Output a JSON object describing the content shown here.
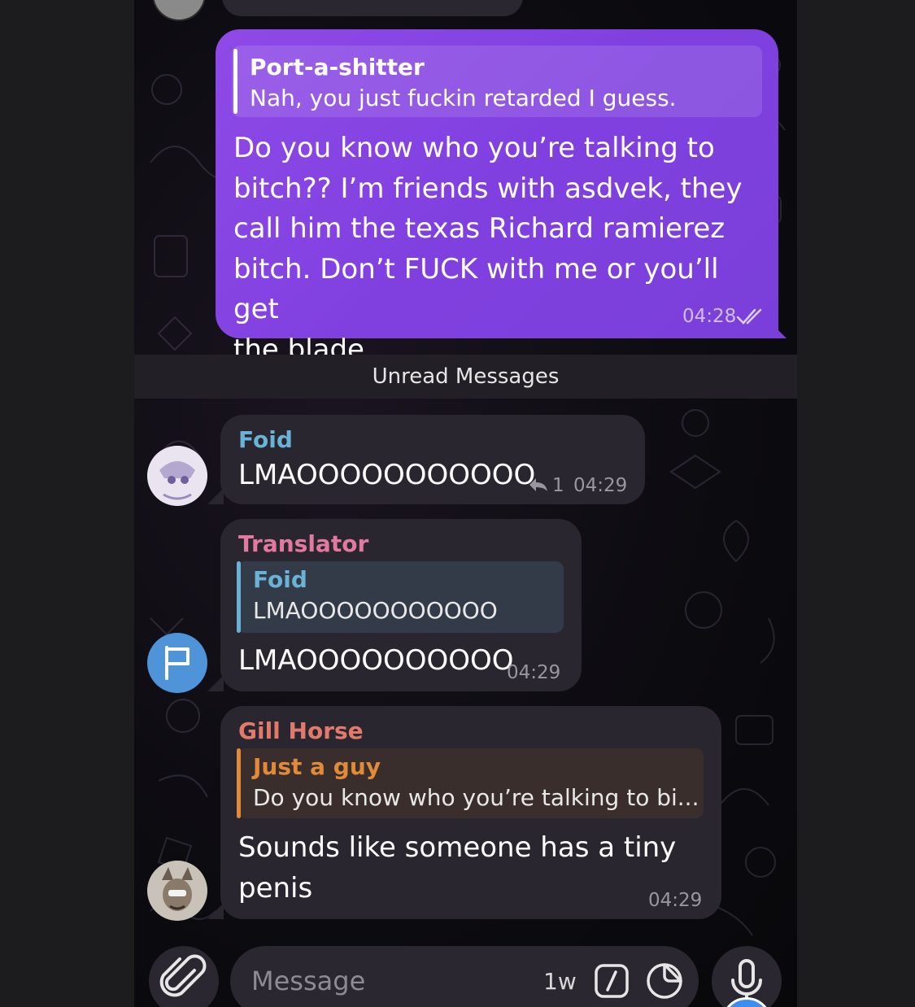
{
  "outgoing": {
    "reply_name": "Port-a-shitter",
    "reply_text": "Nah, you just fuckin retarded I guess.",
    "text_lines": [
      "Do you know who you’re talking to",
      "bitch?? I’m friends with asdvek, they",
      "call him the texas Richard ramierez",
      "bitch. Don’t FUCK with me or you’ll get",
      "the blade"
    ],
    "time": "04:28",
    "read_icon": "double-check-icon"
  },
  "unread_label": "Unread Messages",
  "messages": [
    {
      "sender": "Foid",
      "sender_color": "#6ab2d6",
      "text": "LMAOOOOOOOOOOO",
      "reply_count": "1",
      "reply_icon": "reply-arrow-icon",
      "time": "04:29"
    },
    {
      "sender": "Translator",
      "sender_color": "#e2799f",
      "quote_name": "Foid",
      "quote_text": "LMAOOOOOOOOOOO",
      "text": "LMAOOOOOOOOOO",
      "time": "04:29"
    },
    {
      "sender": "Gill Horse",
      "sender_color": "#e27a6c",
      "quote_name": "Just a guy",
      "quote_text": "Do you know who you’re talking to bi...",
      "text_lines": [
        "Sounds like someone has a tiny",
        "penis"
      ],
      "time": "04:29"
    }
  ],
  "input": {
    "placeholder": "Message",
    "timer_label": "1w",
    "icons": [
      "paperclip-icon",
      "command-icon",
      "sticker-icon",
      "microphone-icon"
    ]
  }
}
